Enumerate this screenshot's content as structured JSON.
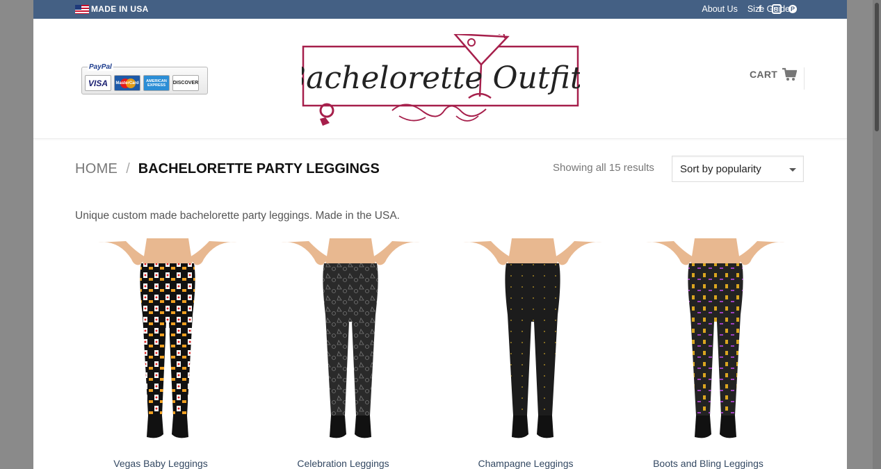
{
  "topbar": {
    "made_in": "MADE IN USA",
    "links": [
      "About Us",
      "Size Guide"
    ],
    "social_icons": [
      "facebook-icon",
      "instagram-icon",
      "pinterest-icon"
    ],
    "color": "#446084"
  },
  "header": {
    "paypal": {
      "label": "PayPal",
      "cards": [
        "VISA",
        "MasterCard",
        "AMERICAN EXPRESS",
        "DISCOVER"
      ]
    },
    "logo_text": "Bachelorette Outfits",
    "cart_label": "CART"
  },
  "breadcrumb": {
    "home": "HOME",
    "separator": "/",
    "current": "BACHELORETTE PARTY LEGGINGS"
  },
  "results_text": "Showing all 15 results",
  "sort": {
    "selected": "Sort by popularity"
  },
  "description": "Unique custom made bachelorette party leggings. Made in the USA.",
  "products": [
    {
      "title": "Vegas Baby Leggings",
      "pattern": "vegas"
    },
    {
      "title": "Celebration Leggings",
      "pattern": "celebration"
    },
    {
      "title": "Champagne Leggings",
      "pattern": "champagne"
    },
    {
      "title": "Boots and Bling Leggings",
      "pattern": "boots"
    }
  ],
  "colors": {
    "brand": "#a61f4b",
    "link": "#334862",
    "accent_bar": "#446084"
  }
}
